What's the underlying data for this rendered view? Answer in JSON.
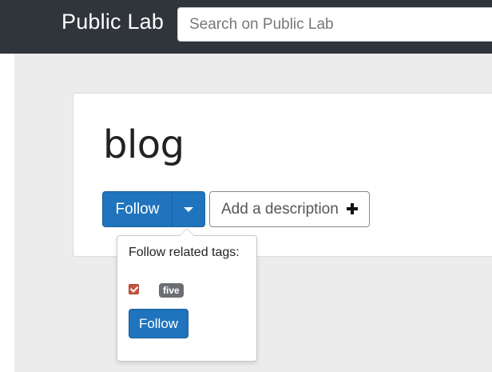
{
  "header": {
    "brand": "Public Lab",
    "search_placeholder": "Search on Public Lab"
  },
  "page": {
    "title": "blog"
  },
  "actions": {
    "follow_label": "Follow",
    "add_description_label": "Add a description"
  },
  "popover": {
    "heading": "Follow related tags:",
    "tags": [
      {
        "label": "five",
        "checked": true
      }
    ],
    "follow_label": "Follow"
  },
  "colors": {
    "topbar": "#2f353b",
    "primary": "#1f74bd",
    "checkbox": "#c8553d",
    "badge": "#6b6f73"
  },
  "icons": {
    "dropdown": "caret-down-icon",
    "add": "plus-icon"
  }
}
